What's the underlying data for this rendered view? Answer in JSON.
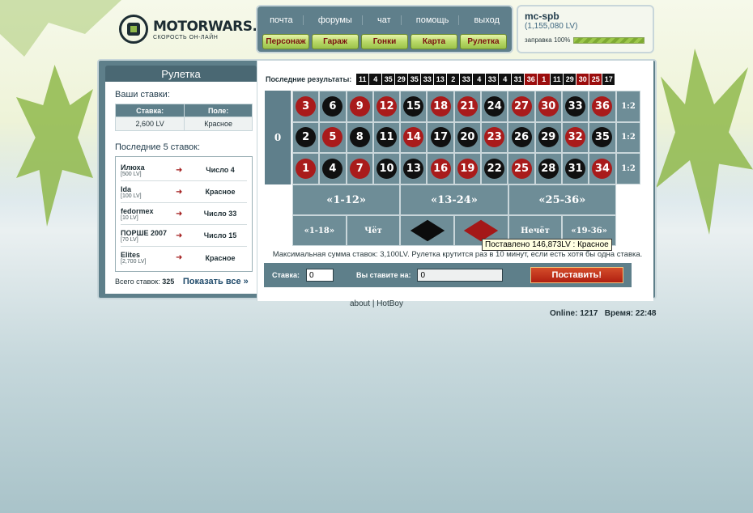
{
  "brand": {
    "name": "MOTORWARS.RU",
    "tagline": "СКОРОСТЬ ОН-ЛАЙН"
  },
  "nav": {
    "links": [
      "почта",
      "форумы",
      "чат",
      "помощь",
      "выход"
    ],
    "buttons": [
      "Персонаж",
      "Гараж",
      "Гонки",
      "Карта",
      "Рулетка"
    ]
  },
  "user": {
    "name": "mc-spb",
    "money": "(1,155,080 LV)",
    "fuel_label": "заправка 100%",
    "fuel_value": 1.0
  },
  "panel": {
    "title": "Рулетка"
  },
  "your_bets": {
    "heading": "Ваши ставки:",
    "columns": [
      "Ставка:",
      "Поле:"
    ],
    "rows": [
      [
        "2,600 LV",
        "Красное"
      ]
    ]
  },
  "last_bets": {
    "heading": "Последние 5 ставок:",
    "items": [
      {
        "name": "Илюха",
        "amount": "[500 LV]",
        "target": "Число 4"
      },
      {
        "name": "Ida",
        "amount": "[100 LV]",
        "target": "Красное"
      },
      {
        "name": "fedormex",
        "amount": "[10 LV]",
        "target": "Число 33"
      },
      {
        "name": "ПОРШЕ 2007",
        "amount": "[70 LV]",
        "target": "Число 15"
      },
      {
        "name": "Elites",
        "amount": "[2,700 LV]",
        "target": "Красное"
      }
    ],
    "total_label": "Всего ставок:",
    "total_value": "325",
    "show_all": "Показать все »"
  },
  "results": {
    "label": "Последние результаты:",
    "values": [
      {
        "n": "11",
        "c": "black"
      },
      {
        "n": "4",
        "c": "black"
      },
      {
        "n": "35",
        "c": "black"
      },
      {
        "n": "29",
        "c": "black"
      },
      {
        "n": "35",
        "c": "black"
      },
      {
        "n": "33",
        "c": "black"
      },
      {
        "n": "13",
        "c": "black"
      },
      {
        "n": "2",
        "c": "black"
      },
      {
        "n": "33",
        "c": "black"
      },
      {
        "n": "4",
        "c": "black"
      },
      {
        "n": "33",
        "c": "black"
      },
      {
        "n": "4",
        "c": "black"
      },
      {
        "n": "31",
        "c": "black"
      },
      {
        "n": "36",
        "c": "red"
      },
      {
        "n": "1",
        "c": "red"
      },
      {
        "n": "11",
        "c": "black"
      },
      {
        "n": "29",
        "c": "black"
      },
      {
        "n": "30",
        "c": "red"
      },
      {
        "n": "25",
        "c": "red"
      },
      {
        "n": "17",
        "c": "black"
      }
    ]
  },
  "table": {
    "zero": "0",
    "rows": [
      [
        {
          "n": "3",
          "c": "red"
        },
        {
          "n": "6",
          "c": "black"
        },
        {
          "n": "9",
          "c": "red"
        },
        {
          "n": "12",
          "c": "red"
        },
        {
          "n": "15",
          "c": "black"
        },
        {
          "n": "18",
          "c": "red"
        },
        {
          "n": "21",
          "c": "red"
        },
        {
          "n": "24",
          "c": "black"
        },
        {
          "n": "27",
          "c": "red"
        },
        {
          "n": "30",
          "c": "red"
        },
        {
          "n": "33",
          "c": "black"
        },
        {
          "n": "36",
          "c": "red"
        }
      ],
      [
        {
          "n": "2",
          "c": "black"
        },
        {
          "n": "5",
          "c": "red"
        },
        {
          "n": "8",
          "c": "black"
        },
        {
          "n": "11",
          "c": "black"
        },
        {
          "n": "14",
          "c": "red"
        },
        {
          "n": "17",
          "c": "black"
        },
        {
          "n": "20",
          "c": "black"
        },
        {
          "n": "23",
          "c": "red"
        },
        {
          "n": "26",
          "c": "black"
        },
        {
          "n": "29",
          "c": "black"
        },
        {
          "n": "32",
          "c": "red"
        },
        {
          "n": "35",
          "c": "black"
        }
      ],
      [
        {
          "n": "1",
          "c": "red"
        },
        {
          "n": "4",
          "c": "black"
        },
        {
          "n": "7",
          "c": "red"
        },
        {
          "n": "10",
          "c": "black"
        },
        {
          "n": "13",
          "c": "black"
        },
        {
          "n": "16",
          "c": "red"
        },
        {
          "n": "19",
          "c": "red"
        },
        {
          "n": "22",
          "c": "black"
        },
        {
          "n": "25",
          "c": "red"
        },
        {
          "n": "28",
          "c": "black"
        },
        {
          "n": "31",
          "c": "black"
        },
        {
          "n": "34",
          "c": "red"
        }
      ]
    ],
    "column_bets": [
      "1:2",
      "1:2",
      "1:2"
    ],
    "dozens": [
      "«1-12»",
      "«13-24»",
      "«25-36»"
    ],
    "outside": {
      "low": "«1-18»",
      "even": "Чёт",
      "odd": "Нечёт",
      "high": "«19-36»"
    }
  },
  "tooltip": "Поставлено 146,873LV : Красное",
  "note": "Максимальная сумма ставок: 3,100LV. Рулетка крутится раз в 10 минут, если есть хотя бы одна ставка.",
  "bet_form": {
    "stake_label": "Ставка:",
    "stake_value": "0",
    "target_label": "Вы ставите на:",
    "target_value": "0",
    "submit": "Поставить!"
  },
  "footer": {
    "links": [
      "about",
      "HotBoy"
    ],
    "separator": "|",
    "online": "Online: 1217   Время: 22:48"
  },
  "colors": {
    "panel": "#5e7f8a",
    "red": "#a91b1b",
    "black": "#101010",
    "accent_green": "#9bc24a"
  }
}
